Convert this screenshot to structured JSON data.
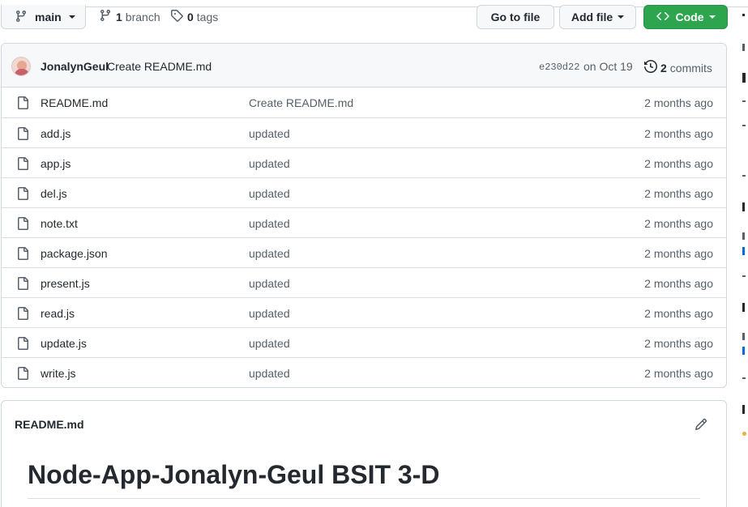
{
  "toolbar": {
    "branch_name": "main",
    "branches_count": "1",
    "branches_label": "branch",
    "tags_count": "0",
    "tags_label": "tags",
    "goto_file": "Go to file",
    "add_file": "Add file",
    "code": "Code"
  },
  "commit": {
    "author": "JonalynGeul",
    "message": "Create README.md",
    "sha": "e230d22",
    "date": "on Oct 19",
    "commits_count": "2",
    "commits_label": "commits"
  },
  "files": [
    {
      "name": "README.md",
      "message": "Create README.md",
      "age": "2 months ago"
    },
    {
      "name": "add.js",
      "message": "updated",
      "age": "2 months ago"
    },
    {
      "name": "app.js",
      "message": "updated",
      "age": "2 months ago"
    },
    {
      "name": "del.js",
      "message": "updated",
      "age": "2 months ago"
    },
    {
      "name": "note.txt",
      "message": "updated",
      "age": "2 months ago"
    },
    {
      "name": "package.json",
      "message": "updated",
      "age": "2 months ago"
    },
    {
      "name": "present.js",
      "message": "updated",
      "age": "2 months ago"
    },
    {
      "name": "read.js",
      "message": "updated",
      "age": "2 months ago"
    },
    {
      "name": "update.js",
      "message": "updated",
      "age": "2 months ago"
    },
    {
      "name": "write.js",
      "message": "updated",
      "age": "2 months ago"
    }
  ],
  "readme": {
    "filename": "README.md",
    "heading": "Node-App-Jonalyn-Geul BSIT 3-D"
  },
  "icons": {
    "branch": "git-branch-icon",
    "tag": "tag-icon",
    "history": "history-icon",
    "file": "file-icon",
    "code": "code-icon",
    "edit": "pencil-icon"
  },
  "colors": {
    "primary_button": "#2da44e",
    "border": "#d0d7de",
    "muted_text": "#57606a",
    "header_bg": "#f6f8fa"
  }
}
